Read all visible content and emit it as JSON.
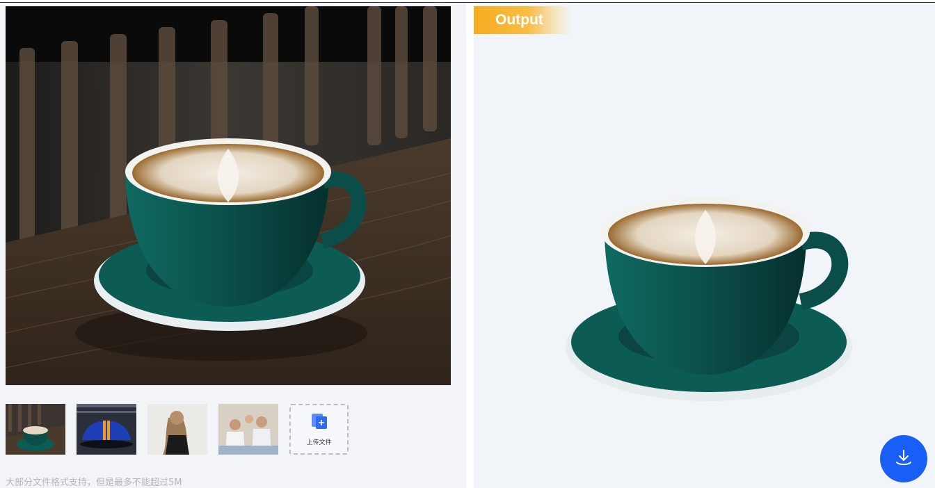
{
  "input": {
    "thumbnails": [
      {
        "name": "thumb-coffee-cup"
      },
      {
        "name": "thumb-sports-car"
      },
      {
        "name": "thumb-woman-hair"
      },
      {
        "name": "thumb-family"
      }
    ],
    "upload_label": "上传文件",
    "hint": "大部分文件格式支持，但是最多不能超过5M"
  },
  "output": {
    "tag_label": "Output"
  },
  "colors": {
    "accent": "#1a5ff5",
    "tag": "#f6ac1f",
    "cup": "#0b4e49",
    "panel": "#f1f4f9"
  },
  "icons": {
    "upload": "upload-file-icon",
    "download": "download-icon"
  }
}
